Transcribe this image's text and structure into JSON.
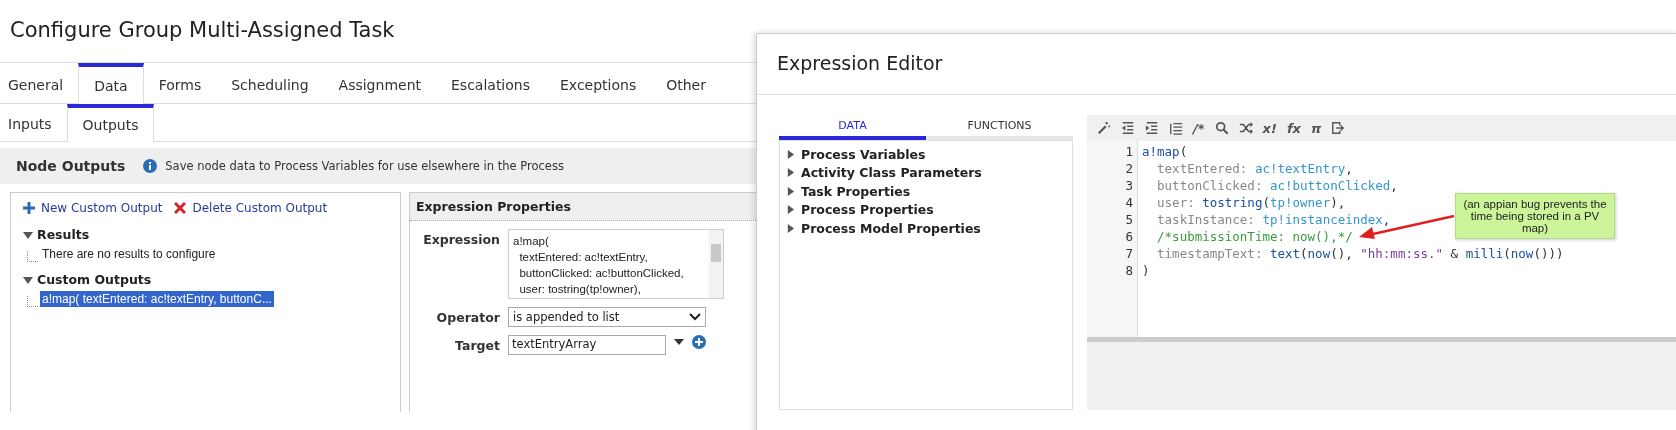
{
  "dialog": {
    "title": "Configure Group Multi-Assigned Task",
    "tabs": [
      {
        "label": "General",
        "selected": false
      },
      {
        "label": "Data",
        "selected": true
      },
      {
        "label": "Forms",
        "selected": false
      },
      {
        "label": "Scheduling",
        "selected": false
      },
      {
        "label": "Assignment",
        "selected": false
      },
      {
        "label": "Escalations",
        "selected": false
      },
      {
        "label": "Exceptions",
        "selected": false
      },
      {
        "label": "Other",
        "selected": false
      }
    ],
    "subtabs": [
      {
        "label": "Inputs",
        "selected": false
      },
      {
        "label": "Outputs",
        "selected": true
      }
    ],
    "section": {
      "title": "Node Outputs",
      "info": "Save node data to Process Variables for use elsewhere in the Process"
    },
    "actions": [
      {
        "kind": "add",
        "label": "New Custom Output"
      },
      {
        "kind": "delete",
        "label": "Delete Custom Output"
      }
    ],
    "tree": [
      {
        "label": "Results",
        "expanded": true,
        "children": [
          {
            "label": "There are no results to configure",
            "selected": false
          }
        ]
      },
      {
        "label": "Custom Outputs",
        "expanded": true,
        "children": [
          {
            "label": "a!map( textEntered: ac!textEntry, buttonC...",
            "selected": true
          }
        ]
      }
    ],
    "properties": {
      "title": "Expression Properties",
      "expression_label": "Expression",
      "expression_lines": [
        "a!map(",
        "  textEntered: ac!textEntry,",
        "  buttonClicked: ac!buttonClicked,",
        "  user: tostring(tp!owner),"
      ],
      "operator_label": "Operator",
      "operator_value": "is appended to list",
      "target_label": "Target",
      "target_value": "textEntryArray"
    }
  },
  "editor": {
    "title": "Expression Editor",
    "tabs": [
      {
        "label": "DATA",
        "selected": true
      },
      {
        "label": "FUNCTIONS",
        "selected": false
      }
    ],
    "tree": [
      {
        "label": "Process Variables",
        "expanded": false
      },
      {
        "label": "Activity Class Parameters",
        "expanded": false
      },
      {
        "label": "Task Properties",
        "expanded": false
      },
      {
        "label": "Process Properties",
        "expanded": false
      },
      {
        "label": "Process Model Properties",
        "expanded": false
      }
    ],
    "toolbar": [
      {
        "kind": "wand"
      },
      {
        "kind": "outdent"
      },
      {
        "kind": "indent"
      },
      {
        "kind": "list"
      },
      {
        "kind": "text",
        "label": "/*"
      },
      {
        "kind": "search"
      },
      {
        "kind": "shuffle"
      },
      {
        "kind": "text",
        "label": "x!"
      },
      {
        "kind": "text",
        "label": "fx"
      },
      {
        "kind": "text",
        "label": "π"
      },
      {
        "kind": "exit"
      }
    ],
    "code": [
      {
        "number": "1",
        "tokens": [
          {
            "kind": "fn",
            "text": "a!map"
          },
          {
            "kind": "plain",
            "text": "("
          }
        ]
      },
      {
        "number": "2",
        "tokens": [
          {
            "kind": "key",
            "text": "  textEntered: "
          },
          {
            "kind": "ref",
            "text": "ac!textEntry"
          },
          {
            "kind": "plain",
            "text": ","
          }
        ]
      },
      {
        "number": "3",
        "tokens": [
          {
            "kind": "key",
            "text": "  buttonClicked: "
          },
          {
            "kind": "ref",
            "text": "ac!buttonClicked"
          },
          {
            "kind": "plain",
            "text": ","
          }
        ]
      },
      {
        "number": "4",
        "tokens": [
          {
            "kind": "key",
            "text": "  user: "
          },
          {
            "kind": "fn",
            "text": "tostring"
          },
          {
            "kind": "plain",
            "text": "("
          },
          {
            "kind": "ref",
            "text": "tp!owner"
          },
          {
            "kind": "plain",
            "text": "),"
          }
        ]
      },
      {
        "number": "5",
        "tokens": [
          {
            "kind": "key",
            "text": "  taskInstance: "
          },
          {
            "kind": "ref",
            "text": "tp!instanceindex"
          },
          {
            "kind": "plain",
            "text": ","
          }
        ]
      },
      {
        "number": "6",
        "tokens": [
          {
            "kind": "comment",
            "text": "  /*submissionTime: now(),*/"
          }
        ]
      },
      {
        "number": "7",
        "tokens": [
          {
            "kind": "key",
            "text": "  timestampText: "
          },
          {
            "kind": "fn",
            "text": "text"
          },
          {
            "kind": "plain",
            "text": "("
          },
          {
            "kind": "fn",
            "text": "now"
          },
          {
            "kind": "plain",
            "text": "(), "
          },
          {
            "kind": "str",
            "text": "\"hh:mm:ss.\""
          },
          {
            "kind": "plain",
            "text": " & "
          },
          {
            "kind": "fn",
            "text": "milli"
          },
          {
            "kind": "plain",
            "text": "("
          },
          {
            "kind": "fn",
            "text": "now"
          },
          {
            "kind": "plain",
            "text": "()))"
          }
        ]
      },
      {
        "number": "8",
        "tokens": [
          {
            "kind": "plain",
            "text": ")"
          }
        ]
      }
    ],
    "callout": "(an appian bug prevents the time being stored in a PV map)"
  }
}
